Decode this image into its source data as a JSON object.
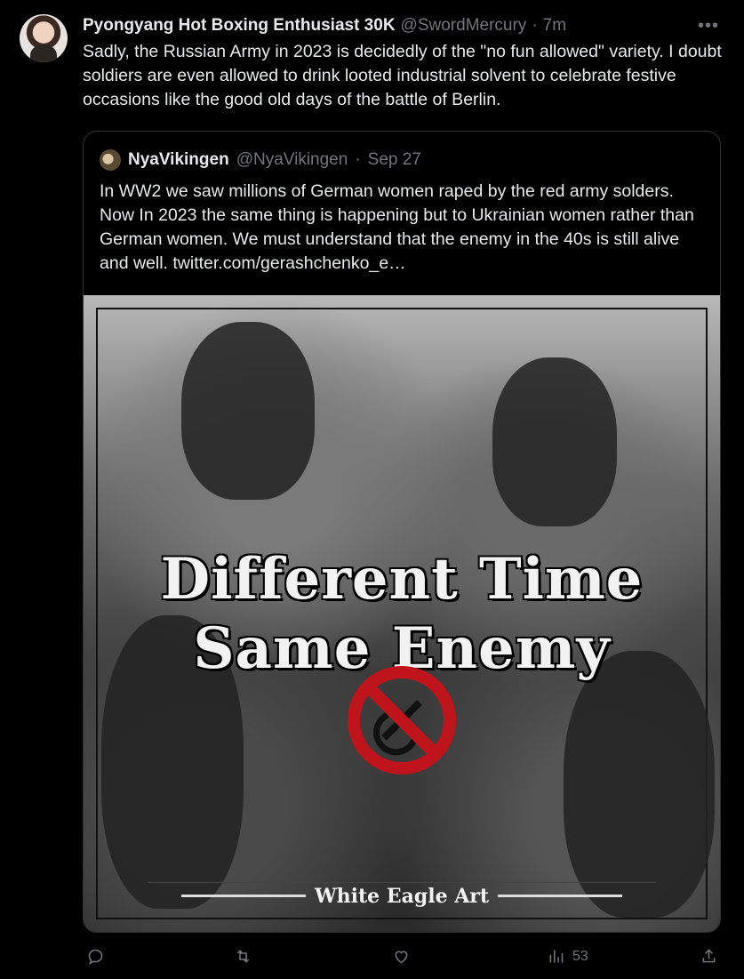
{
  "tweet": {
    "display_name": "Pyongyang Hot Boxing Enthusiast 30K",
    "handle": "@SwordMercury",
    "separator": "·",
    "time": "7m",
    "more": "•••",
    "text": "Sadly, the Russian Army in 2023 is decidedly of the \"no fun allowed\" variety. I doubt soldiers are even allowed to drink looted industrial solvent to celebrate festive occasions like the good old days of the battle of Berlin."
  },
  "quote": {
    "display_name": "NyaVikingen",
    "handle": "@NyaVikingen",
    "separator": "·",
    "date": "Sep 27",
    "text": "In WW2 we saw millions of German women raped by the red army solders. Now In 2023 the same thing is happening but to Ukrainian women rather than German women. We must understand that the enemy in the 40s is still alive and well.  twitter.com/gerashchenko_e…",
    "image": {
      "title_line1": "Different Time",
      "title_line2": "Same Enemy",
      "banner": "White Eagle Art",
      "colors": {
        "ban_red": "#c0141c"
      }
    }
  },
  "actions": {
    "views_count": "53",
    "icons": [
      "reply-icon",
      "retweet-icon",
      "like-icon",
      "views-icon",
      "share-icon"
    ]
  },
  "colors": {
    "background": "#000000",
    "text": "#e7e9ea",
    "muted": "#71767b",
    "border": "#2f3336"
  }
}
